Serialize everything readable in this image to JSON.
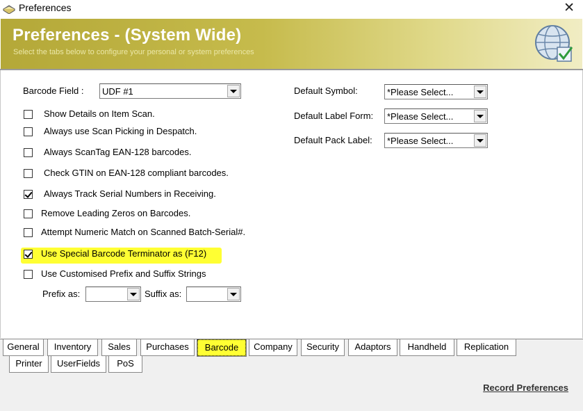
{
  "window": {
    "title": "Preferences",
    "close_glyph": "✕"
  },
  "header": {
    "title": "Preferences - (System Wide)",
    "subtitle": "Select the tabs below to configure your personal or system preferences",
    "icon": "globe-check-icon"
  },
  "barcode_field": {
    "label": "Barcode Field :",
    "value": "UDF #1"
  },
  "options": [
    {
      "label": "Show Details on Item Scan.",
      "checked": false
    },
    {
      "label": "Always use Scan Picking in Despatch.",
      "checked": false
    },
    {
      "label": "Always ScanTag EAN-128 barcodes.",
      "checked": false
    },
    {
      "label": "Check GTIN on EAN-128 compliant barcodes.",
      "checked": false
    },
    {
      "label": "Always Track Serial Numbers in Receiving.",
      "checked": true
    },
    {
      "label": "Remove Leading Zeros on Barcodes.",
      "checked": false
    },
    {
      "label": "Attempt Numeric Match on Scanned Batch-Serial#.",
      "checked": false
    },
    {
      "label": "Use Special Barcode Terminator as (F12)",
      "checked": true
    },
    {
      "label": "Use Customised Prefix and Suffix Strings",
      "checked": false
    }
  ],
  "prefix": {
    "label": "Prefix as:",
    "value": ""
  },
  "suffix": {
    "label": "Suffix as:",
    "value": ""
  },
  "defaults": [
    {
      "label": "Default Symbol:",
      "value": "*Please Select..."
    },
    {
      "label": "Default Label Form:",
      "value": "*Please Select..."
    },
    {
      "label": "Default Pack Label:",
      "value": "*Please Select..."
    }
  ],
  "tabs_row1": [
    "General",
    "Inventory",
    "Sales",
    "Purchases",
    "Barcode",
    "Company",
    "Security",
    "Adaptors",
    "Handheld",
    "Replication"
  ],
  "tabs_row2": [
    "Printer",
    "UserFields",
    "PoS"
  ],
  "active_tab": "Barcode",
  "footer": {
    "record_label": "Record Preferences"
  },
  "colors": {
    "highlight": "#ffff33",
    "banner": "#c6bb4c"
  }
}
